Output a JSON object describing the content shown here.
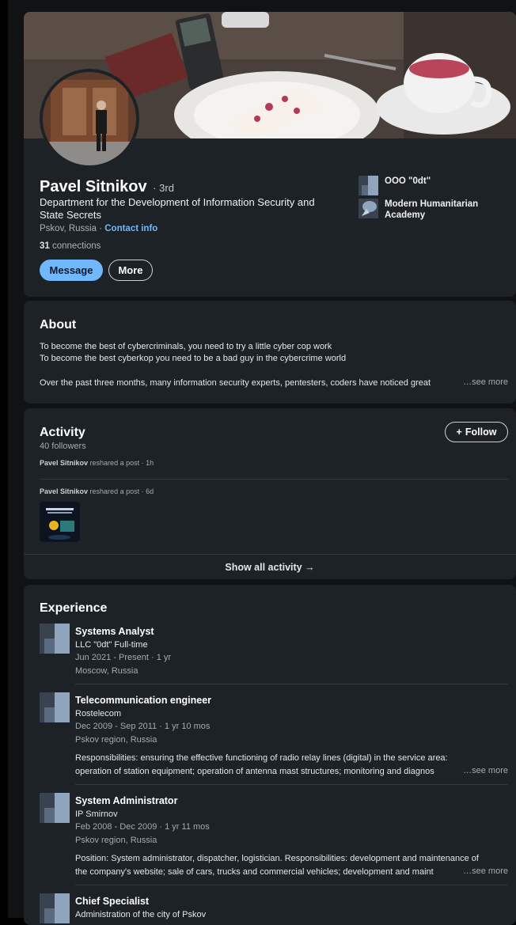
{
  "profile": {
    "name": "Pavel Sitnikov",
    "degree": "· 3rd",
    "headline": "Department for the Development of Information Security and State Secrets",
    "location": "Pskov, Russia ·",
    "contact_info": "Contact info",
    "connections_count": "31",
    "connections_label": "connections",
    "message_button": "Message",
    "more_button": "More",
    "orgs": [
      {
        "name": "OOO \"0dt\""
      },
      {
        "name": "Modern Humanitarian Academy"
      }
    ]
  },
  "about": {
    "title": "About",
    "line1": "To become the best of cybercriminals, you need to try a little cyber cop work",
    "line2": "To become the best cyberkop you need to be a bad guy in the cybercrime world",
    "line3": "Over the past three months, many information security experts, pentesters, coders have noticed great",
    "see_more": "…see more"
  },
  "activity": {
    "title": "Activity",
    "followers": "40 followers",
    "follow_button": "Follow",
    "posts": [
      {
        "author": "Pavel Sitnikov",
        "text": "reshared a post · 1h"
      },
      {
        "author": "Pavel Sitnikov",
        "text": "reshared a post · 6d"
      }
    ],
    "show_all": "Show all activity →"
  },
  "experience": {
    "title": "Experience",
    "items": [
      {
        "title": "Systems Analyst",
        "company": "LLC \"0dt\" Full-time",
        "dates": "Jun 2021 - Present · 1 yr",
        "location": "Moscow, Russia"
      },
      {
        "title": "Telecommunication engineer",
        "company": "Rostelecom",
        "dates": "Dec 2009 - Sep 2011 · 1 yr 10 mos",
        "location": "Pskov region, Russia",
        "desc1": "Responsibilities: ensuring the effective functioning of radio relay lines (digital) in the service area:",
        "desc2": "operation of station equipment; operation of antenna mast structures; monitoring and diagnos",
        "see_more": "…see more"
      },
      {
        "title": "System Administrator",
        "company": "IP Smirnov",
        "dates": "Feb 2008 - Dec 2009 · 1 yr 11 mos",
        "location": "Pskov region, Russia",
        "desc1": "Position: System administrator, dispatcher, logistician. Responsibilities: development and maintenance of",
        "desc2": "the company's website; sale of cars, trucks and commercial vehicles; development and maint",
        "see_more": "…see more"
      },
      {
        "title": "Chief Specialist",
        "company": "Administration of the city of Pskov"
      }
    ]
  },
  "colors": {
    "primary": "#71b7fb",
    "card": "#1d2226",
    "page": "#111214"
  }
}
